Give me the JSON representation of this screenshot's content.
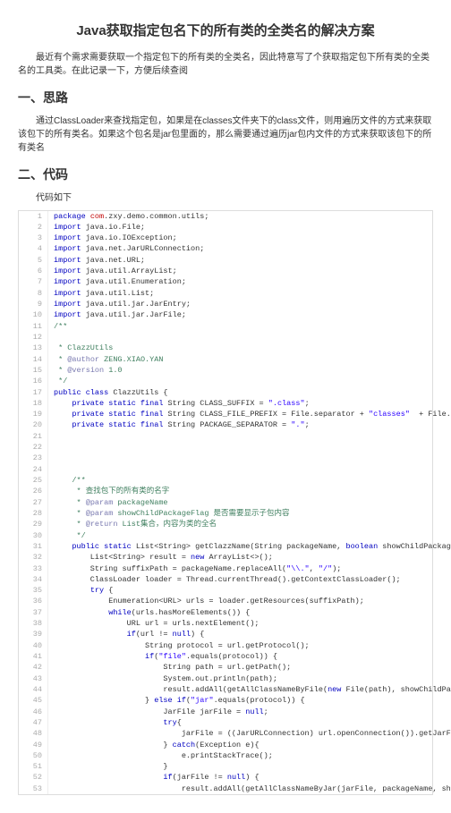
{
  "title": "Java获取指定包名下的所有类的全类名的解决方案",
  "intro": "最近有个需求需要获取一个指定包下的所有类的全类名，因此特意写了个获取指定包下所有类的全类名的工具类。在此记录一下，方便后续查阅",
  "h2_1": "一、思路",
  "para1": "通过ClassLoader来查找指定包，如果是在classes文件夹下的class文件，则用遍历文件的方式来获取该包下的所有类名。如果这个包名是jar包里面的，那么需要通过遍历jar包内文件的方式来获取该包下的所有类名",
  "h2_2": "二、代码",
  "para2": "代码如下",
  "code": [
    {
      "n": 1,
      "h": "<span class='kw'>package</span> <span class='highlight'>com</span>.zxy.demo.common.utils;"
    },
    {
      "n": 2,
      "h": "<span class='kw'>import</span> java.io.File;"
    },
    {
      "n": 3,
      "h": "<span class='kw'>import</span> java.io.IOException;"
    },
    {
      "n": 4,
      "h": "<span class='kw'>import</span> java.net.JarURLConnection;"
    },
    {
      "n": 5,
      "h": "<span class='kw'>import</span> java.net.URL;"
    },
    {
      "n": 6,
      "h": "<span class='kw'>import</span> java.util.ArrayList;"
    },
    {
      "n": 7,
      "h": "<span class='kw'>import</span> java.util.Enumeration;"
    },
    {
      "n": 8,
      "h": "<span class='kw'>import</span> java.util.List;"
    },
    {
      "n": 9,
      "h": "<span class='kw'>import</span> java.util.jar.JarEntry;"
    },
    {
      "n": 10,
      "h": "<span class='kw'>import</span> java.util.jar.JarFile;"
    },
    {
      "n": 11,
      "h": "<span class='cmt'>/**</span>"
    },
    {
      "n": 12,
      "h": ""
    },
    {
      "n": 13,
      "h": "<span class='cmt'> * ClazzUtils</span>"
    },
    {
      "n": 14,
      "h": "<span class='cmt'> * </span><span class='doc-tag'>@author</span><span class='cmt'> ZENG.XIAO.YAN</span>"
    },
    {
      "n": 15,
      "h": "<span class='cmt'> * </span><span class='doc-tag'>@version</span><span class='cmt'> 1.0</span>"
    },
    {
      "n": 16,
      "h": "<span class='cmt'> */</span>"
    },
    {
      "n": 17,
      "h": "<span class='kw'>public class</span> ClazzUtils {"
    },
    {
      "n": 18,
      "h": "    <span class='kw'>private static final</span> String CLASS_SUFFIX = <span class='str'>\".class\"</span>;"
    },
    {
      "n": 19,
      "h": "    <span class='kw'>private static final</span> String CLASS_FILE_PREFIX = File.separator + <span class='str'>\"classes\"</span>  + File.separator;"
    },
    {
      "n": 20,
      "h": "    <span class='kw'>private static final</span> String PACKAGE_SEPARATOR = <span class='str'>\".\"</span>;"
    },
    {
      "n": 21,
      "h": ""
    },
    {
      "n": 22,
      "h": ""
    },
    {
      "n": 23,
      "h": ""
    },
    {
      "n": 24,
      "h": ""
    },
    {
      "n": 25,
      "h": "    <span class='cmt'>/**</span>"
    },
    {
      "n": 26,
      "h": "<span class='cmt'>     * 查找包下的所有类的名字</span>"
    },
    {
      "n": 27,
      "h": "<span class='cmt'>     * </span><span class='doc-tag'>@param</span><span class='cmt'> packageName</span>"
    },
    {
      "n": 28,
      "h": "<span class='cmt'>     * </span><span class='doc-tag'>@param</span><span class='cmt'> showChildPackageFlag 是否需要显示子包内容</span>"
    },
    {
      "n": 29,
      "h": "<span class='cmt'>     * </span><span class='doc-tag'>@return</span><span class='cmt'> List集合，内容为类的全名</span>"
    },
    {
      "n": 30,
      "h": "<span class='cmt'>     */</span>"
    },
    {
      "n": 31,
      "h": "    <span class='kw'>public static</span> List&lt;String&gt; getClazzName(String packageName, <span class='kw'>boolean</span> showChildPackageFlag ) {"
    },
    {
      "n": 32,
      "h": "        List&lt;String&gt; result = <span class='kw'>new</span> ArrayList&lt;&gt;();"
    },
    {
      "n": 33,
      "h": "        String suffixPath = packageName.replaceAll(<span class='str'>\"\\\\.\"</span>, <span class='str'>\"/\"</span>);"
    },
    {
      "n": 34,
      "h": "        ClassLoader loader = Thread.currentThread().getContextClassLoader();"
    },
    {
      "n": 35,
      "h": "        <span class='kw'>try</span> {"
    },
    {
      "n": 36,
      "h": "            Enumeration&lt;URL&gt; urls = loader.getResources(suffixPath);"
    },
    {
      "n": 37,
      "h": "            <span class='kw'>while</span>(urls.hasMoreElements()) {"
    },
    {
      "n": 38,
      "h": "                URL url = urls.nextElement();"
    },
    {
      "n": 39,
      "h": "                <span class='kw'>if</span>(url != <span class='kw'>null</span>) {"
    },
    {
      "n": 40,
      "h": "                    String protocol = url.getProtocol();"
    },
    {
      "n": 41,
      "h": "                    <span class='kw'>if</span>(<span class='str'>\"file\"</span>.equals(protocol)) {"
    },
    {
      "n": 42,
      "h": "                        String path = url.getPath();"
    },
    {
      "n": 43,
      "h": "                        System.out.println(path);"
    },
    {
      "n": 44,
      "h": "                        result.addAll(getAllClassNameByFile(<span class='kw'>new</span> File(path), showChildPackageFlag));"
    },
    {
      "n": 45,
      "h": "                    } <span class='kw'>else if</span>(<span class='str'>\"jar\"</span>.equals(protocol)) {"
    },
    {
      "n": 46,
      "h": "                        JarFile jarFile = <span class='kw'>null</span>;"
    },
    {
      "n": 47,
      "h": "                        <span class='kw'>try</span>{"
    },
    {
      "n": 48,
      "h": "                            jarFile = ((JarURLConnection) url.openConnection()).getJarFile();"
    },
    {
      "n": 49,
      "h": "                        } <span class='kw'>catch</span>(Exception e){"
    },
    {
      "n": 50,
      "h": "                            e.printStackTrace();"
    },
    {
      "n": 51,
      "h": "                        }"
    },
    {
      "n": 52,
      "h": "                        <span class='kw'>if</span>(jarFile != <span class='kw'>null</span>) {"
    },
    {
      "n": 53,
      "h": "                            result.addAll(getAllClassNameByJar(jarFile, packageName, showChildPackageFlag));"
    }
  ]
}
